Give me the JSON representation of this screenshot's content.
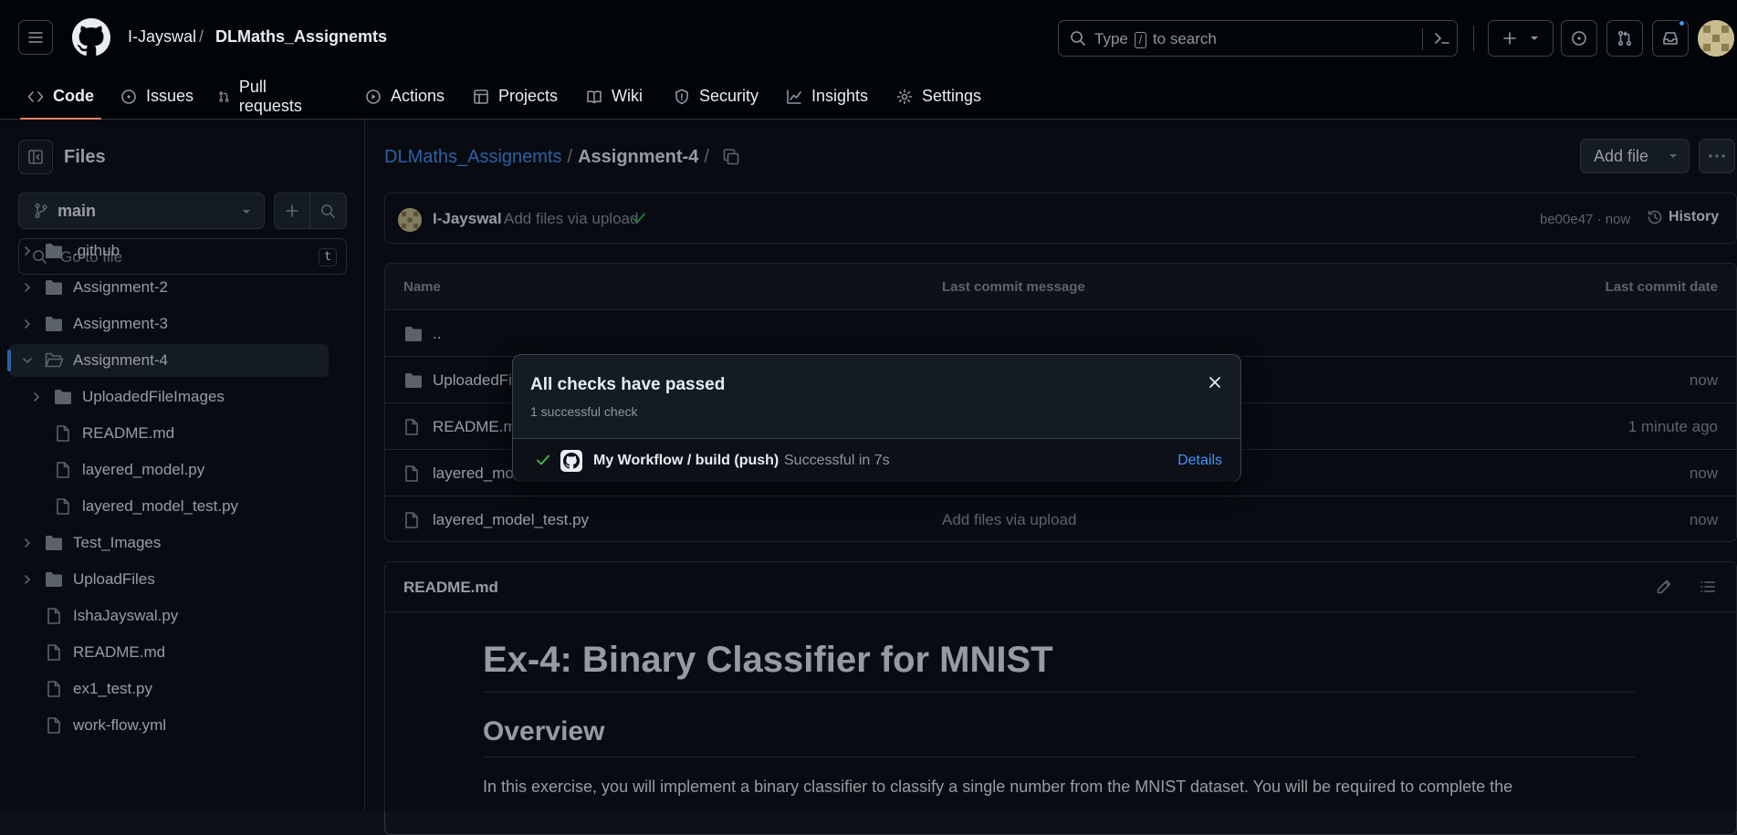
{
  "header": {
    "owner": "I-Jayswal",
    "separator": "/",
    "repo": "DLMaths_Assignemts",
    "search": {
      "prefix": "Type",
      "key": "/",
      "suffix": "to search"
    }
  },
  "repo_nav": [
    {
      "label": "Code",
      "icon": "code-icon"
    },
    {
      "label": "Issues",
      "icon": "issues-icon"
    },
    {
      "label": "Pull requests",
      "icon": "pull-request-icon"
    },
    {
      "label": "Actions",
      "icon": "play-icon"
    },
    {
      "label": "Projects",
      "icon": "table-icon"
    },
    {
      "label": "Wiki",
      "icon": "book-icon"
    },
    {
      "label": "Security",
      "icon": "shield-icon"
    },
    {
      "label": "Insights",
      "icon": "graph-icon"
    },
    {
      "label": "Settings",
      "icon": "gear-icon"
    }
  ],
  "sidebar": {
    "title": "Files",
    "branch": "main",
    "goto_placeholder": "Go to file",
    "goto_key": "t",
    "tree": [
      {
        "label": ".github",
        "type": "folder"
      },
      {
        "label": "Assignment-2",
        "type": "folder"
      },
      {
        "label": "Assignment-3",
        "type": "folder"
      },
      {
        "label": "Assignment-4",
        "type": "folder-open"
      },
      {
        "label": "UploadedFileImages",
        "type": "folder"
      },
      {
        "label": "README.md",
        "type": "file"
      },
      {
        "label": "layered_model.py",
        "type": "file"
      },
      {
        "label": "layered_model_test.py",
        "type": "file"
      },
      {
        "label": "Test_Images",
        "type": "folder"
      },
      {
        "label": "UploadFiles",
        "type": "folder"
      },
      {
        "label": "IshaJayswal.py",
        "type": "file"
      },
      {
        "label": "README.md",
        "type": "file"
      },
      {
        "label": "ex1_test.py",
        "type": "file"
      },
      {
        "label": "work-flow.yml",
        "type": "file"
      }
    ]
  },
  "main": {
    "path": {
      "repo": "DLMaths_Assignemts",
      "sep": "/",
      "folder": "Assignment-4",
      "trail": "/"
    },
    "add_file": "Add file",
    "commit": {
      "author": "I-Jayswal",
      "message": "Add files via upload",
      "meta": "be00e47 · now",
      "history": "History"
    },
    "table": {
      "headers": {
        "name": "Name",
        "message": "Last commit message",
        "date": "Last commit date"
      },
      "rows": [
        {
          "name": "..",
          "message": "",
          "date": "",
          "type": "folder"
        },
        {
          "name": "UploadedFileImages",
          "message": "",
          "date": "now",
          "type": "folder"
        },
        {
          "name": "README.md",
          "message": "",
          "date": "1 minute ago",
          "type": "file"
        },
        {
          "name": "layered_model.py",
          "message": "",
          "date": "now",
          "type": "file"
        },
        {
          "name": "layered_model_test.py",
          "message": "Add files via upload",
          "date": "now",
          "type": "file"
        }
      ]
    },
    "readme": {
      "title": "README.md",
      "h1": "Ex-4: Binary Classifier for MNIST",
      "h2": "Overview",
      "p": "In this exercise, you will implement a binary classifier to classify a single number from the MNIST dataset. You will be required to complete the"
    }
  },
  "popover": {
    "title": "All checks have passed",
    "subtitle": "1 successful check",
    "check_name": "My Workflow / build (push)",
    "check_status": "Successful in 7s",
    "details": "Details"
  }
}
